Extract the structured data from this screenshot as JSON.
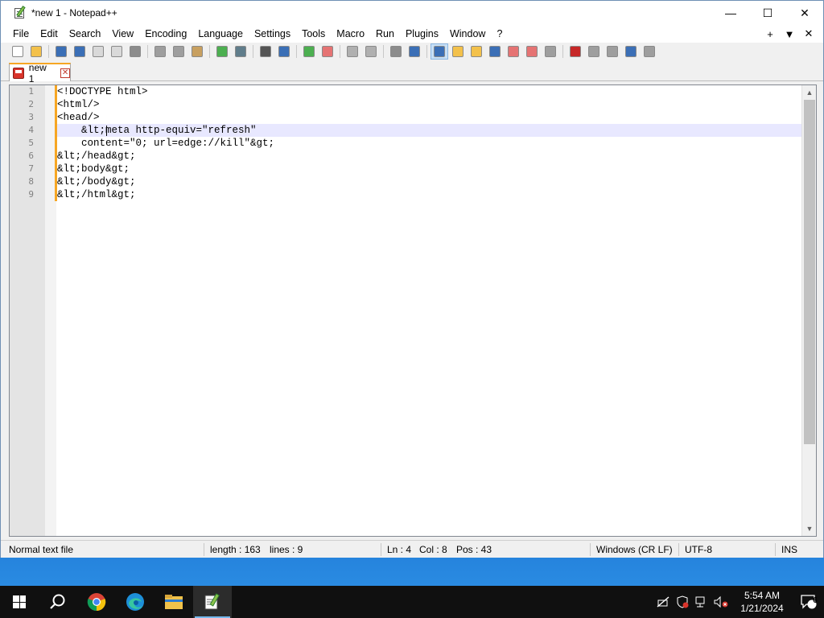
{
  "window": {
    "title": "*new 1 - Notepad++",
    "minimize_glyph": "—",
    "maximize_glyph": "☐",
    "close_glyph": "✕"
  },
  "menu": {
    "items": [
      "File",
      "Edit",
      "Search",
      "View",
      "Encoding",
      "Language",
      "Settings",
      "Tools",
      "Macro",
      "Run",
      "Plugins",
      "Window",
      "?"
    ],
    "right_glyphs": [
      "+",
      "▼",
      "✕"
    ]
  },
  "toolbar": {
    "buttons": [
      {
        "icon": "new-file-icon",
        "color": "#ffffff"
      },
      {
        "icon": "open-file-icon",
        "color": "#f3c14b"
      },
      {
        "icon": "save-icon",
        "color": "#3b6fb6"
      },
      {
        "icon": "save-all-icon",
        "color": "#3b6fb6"
      },
      {
        "icon": "close-icon",
        "color": "#d9d9d9"
      },
      {
        "icon": "close-all-icon",
        "color": "#d9d9d9"
      },
      {
        "icon": "print-icon",
        "color": "#8c8c8c"
      },
      {
        "icon": "cut-icon",
        "color": "#9e9e9e"
      },
      {
        "icon": "copy-icon",
        "color": "#9e9e9e"
      },
      {
        "icon": "paste-icon",
        "color": "#c8a060"
      },
      {
        "icon": "undo-icon",
        "color": "#4caf50"
      },
      {
        "icon": "redo-icon",
        "color": "#607d8b"
      },
      {
        "icon": "find-icon",
        "color": "#555555"
      },
      {
        "icon": "replace-icon",
        "color": "#3b6fb6"
      },
      {
        "icon": "zoom-in-icon",
        "color": "#4caf50"
      },
      {
        "icon": "zoom-out-icon",
        "color": "#e57373"
      },
      {
        "icon": "sync-vertical-icon",
        "color": "#b0b0b0"
      },
      {
        "icon": "sync-horizontal-icon",
        "color": "#b0b0b0"
      },
      {
        "icon": "word-wrap-icon",
        "color": "#8c8c8c"
      },
      {
        "icon": "show-all-chars-icon",
        "color": "#3b6fb6"
      },
      {
        "icon": "indent-guide-icon",
        "color": "#3b6fb6",
        "selected": true
      },
      {
        "icon": "udl-icon",
        "color": "#f3c14b"
      },
      {
        "icon": "function-list-icon",
        "color": "#f3c14b"
      },
      {
        "icon": "doc-map-icon",
        "color": "#3b6fb6"
      },
      {
        "icon": "doc-list-icon",
        "color": "#e57373"
      },
      {
        "icon": "folder-workspace-icon",
        "color": "#e57373"
      },
      {
        "icon": "monitoring-icon",
        "color": "#9e9e9e"
      },
      {
        "icon": "record-macro-icon",
        "color": "#c62828"
      },
      {
        "icon": "stop-macro-icon",
        "color": "#9e9e9e"
      },
      {
        "icon": "play-macro-icon",
        "color": "#9e9e9e"
      },
      {
        "icon": "run-macro-multiple-icon",
        "color": "#3b6fb6"
      },
      {
        "icon": "save-macro-icon",
        "color": "#9e9e9e"
      }
    ],
    "separators_after": [
      1,
      6,
      9,
      11,
      13,
      15,
      17,
      19,
      26
    ]
  },
  "tabs": [
    {
      "label": "new 1",
      "close_glyph": "✕"
    }
  ],
  "editor": {
    "lines": [
      {
        "num": "1",
        "text": "<!DOCTYPE html>"
      },
      {
        "num": "2",
        "text": "<html/>"
      },
      {
        "num": "3",
        "text": "<head/>"
      },
      {
        "num": "4",
        "text": "    &lt;meta http-equiv=\"refresh\"",
        "current": true
      },
      {
        "num": "5",
        "text": "    content=\"0; url=edge://kill\"&gt;"
      },
      {
        "num": "6",
        "text": "&lt;/head&gt;"
      },
      {
        "num": "7",
        "text": "&lt;body&gt;"
      },
      {
        "num": "8",
        "text": "&lt;/body&gt;"
      },
      {
        "num": "9",
        "text": "&lt;/html&gt;"
      }
    ],
    "scroll_up_glyph": "▲",
    "scroll_down_glyph": "▼"
  },
  "status": {
    "file_type": "Normal text file",
    "length": "length : 163",
    "lines": "lines : 9",
    "ln": "Ln : 4",
    "col": "Col : 8",
    "pos": "Pos : 43",
    "eol": "Windows (CR LF)",
    "encoding": "UTF-8",
    "mode": "INS"
  },
  "taskbar": {
    "apps": [
      {
        "icon": "start-icon"
      },
      {
        "icon": "search-icon"
      },
      {
        "icon": "chrome-icon"
      },
      {
        "icon": "edge-icon"
      },
      {
        "icon": "file-explorer-icon"
      },
      {
        "icon": "notepadpp-icon",
        "active": true
      }
    ],
    "tray_icons": [
      "network-off-icon",
      "security-alert-icon",
      "network-icon",
      "volume-muted-icon"
    ],
    "time": "5:54 AM",
    "date": "1/21/2024",
    "notification_count": "6"
  }
}
